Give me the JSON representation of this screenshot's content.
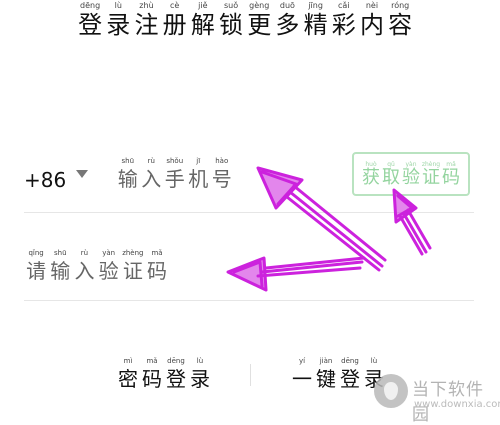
{
  "headline": {
    "chars": [
      {
        "hz": "登",
        "py": "dēng"
      },
      {
        "hz": "录",
        "py": "lù"
      },
      {
        "hz": "注",
        "py": "zhù"
      },
      {
        "hz": "册",
        "py": "cè"
      },
      {
        "hz": "解",
        "py": "jiě"
      },
      {
        "hz": "锁",
        "py": "suǒ"
      },
      {
        "hz": "更",
        "py": "gèng"
      },
      {
        "hz": "多",
        "py": "duō"
      },
      {
        "hz": "精",
        "py": "jīng"
      },
      {
        "hz": "彩",
        "py": "cǎi"
      },
      {
        "hz": "内",
        "py": "nèi"
      },
      {
        "hz": "容",
        "py": "róng"
      }
    ]
  },
  "phone": {
    "country_code": "+86",
    "placeholder": [
      {
        "hz": "输",
        "py": "shū"
      },
      {
        "hz": "入",
        "py": "rù"
      },
      {
        "hz": "手",
        "py": "shǒu"
      },
      {
        "hz": "机",
        "py": "jī"
      },
      {
        "hz": "号",
        "py": "hào"
      }
    ]
  },
  "get_code_button": [
    {
      "hz": "获",
      "py": "huò"
    },
    {
      "hz": "取",
      "py": "qǔ"
    },
    {
      "hz": "验",
      "py": "yàn"
    },
    {
      "hz": "证",
      "py": "zhèng"
    },
    {
      "hz": "码",
      "py": "mǎ"
    }
  ],
  "code_input": {
    "placeholder": [
      {
        "hz": "请",
        "py": "qǐng"
      },
      {
        "hz": "输",
        "py": "shū"
      },
      {
        "hz": "入",
        "py": "rù"
      },
      {
        "hz": "验",
        "py": "yàn"
      },
      {
        "hz": "证",
        "py": "zhèng"
      },
      {
        "hz": "码",
        "py": "mǎ"
      }
    ]
  },
  "login_options": {
    "password_login": [
      {
        "hz": "密",
        "py": "mì"
      },
      {
        "hz": "码",
        "py": "mǎ"
      },
      {
        "hz": "登",
        "py": "dēng"
      },
      {
        "hz": "录",
        "py": "lù"
      }
    ],
    "one_key_login": [
      {
        "hz": "一",
        "py": "yí"
      },
      {
        "hz": "键",
        "py": "jiàn"
      },
      {
        "hz": "登",
        "py": "dēng"
      },
      {
        "hz": "录",
        "py": "lù"
      }
    ]
  },
  "watermark": {
    "name": "当下软件园",
    "url": "www.downxia.com"
  },
  "colors": {
    "annotation_arrow": "#cc22dd",
    "button_border": "#b9e3c0",
    "button_text": "#94d49f"
  }
}
